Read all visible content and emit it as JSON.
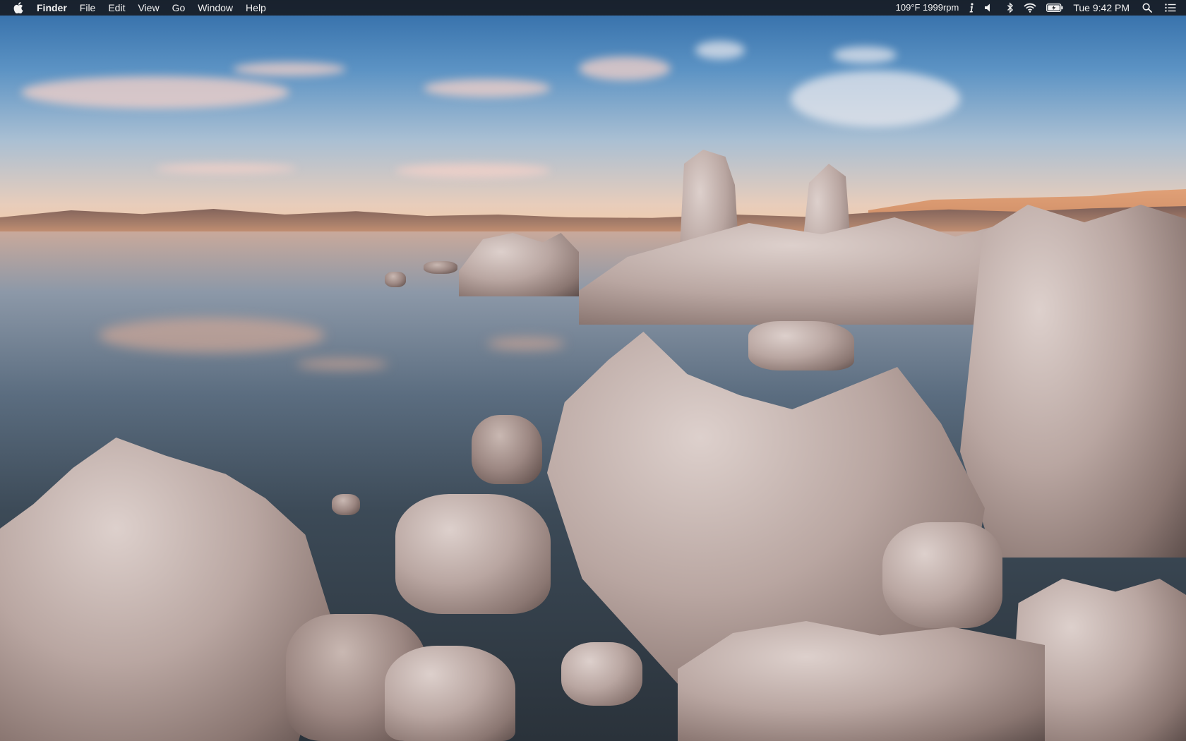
{
  "menubar": {
    "app_name": "Finder",
    "menus": [
      "File",
      "Edit",
      "View",
      "Go",
      "Window",
      "Help"
    ],
    "status": {
      "sensors": "109°F 1999rpm",
      "clock": "Tue 9:42 PM"
    },
    "icons": [
      "apple-icon",
      "info-icon",
      "volume-icon",
      "bluetooth-icon",
      "wifi-icon",
      "battery-icon",
      "spotlight-icon",
      "notification-center-icon"
    ]
  },
  "colors": {
    "menubar_bg": "#16181e",
    "sky_top": "#2f6aa6",
    "horizon_glow": "#f1c9a6",
    "tufa_rock": "#b9a6a1",
    "water_deep": "#2a323a"
  }
}
